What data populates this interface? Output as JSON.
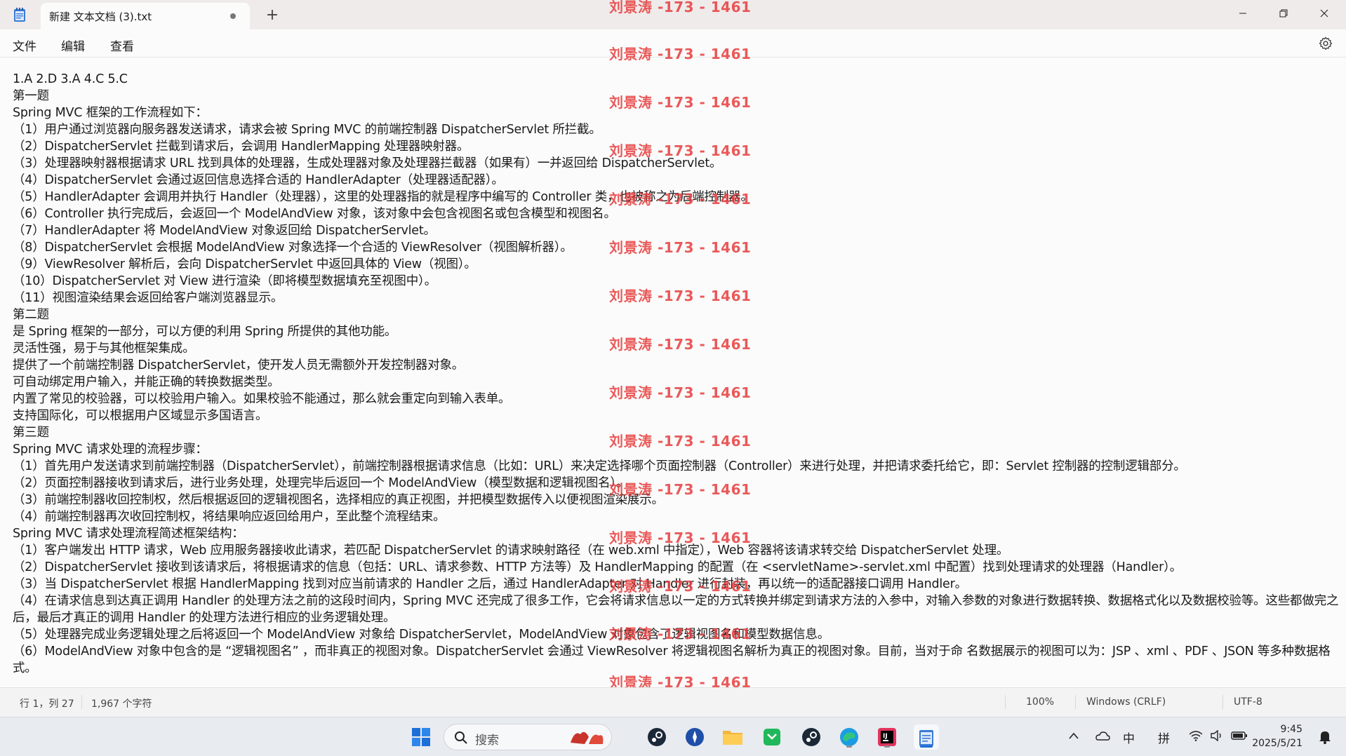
{
  "window": {
    "tab_title": "新建 文本文档 (3).txt",
    "new_tab_label": "+",
    "minimize_icon": "minimize-icon",
    "maximize_icon": "restore-icon",
    "close_icon": "close-icon"
  },
  "menu": {
    "file": "文件",
    "edit": "编辑",
    "view": "查看"
  },
  "document": {
    "lines": [
      "1.A   2.D  3.A   4.C   5.C",
      "第一题",
      "Spring MVC 框架的工作流程如下：",
      "（1）用户通过浏览器向服务器发送请求，请求会被 Spring MVC 的前端控制器 DispatcherServlet 所拦截。",
      "（2）DispatcherServlet 拦截到请求后，会调用 HandlerMapping 处理器映射器。",
      "（3）处理器映射器根据请求 URL 找到具体的处理器，生成处理器对象及处理器拦截器（如果有）一并返回给 DispatcherServlet。",
      "（4）DispatcherServlet 会通过返回信息选择合适的 HandlerAdapter（处理器适配器）。",
      "（5）HandlerAdapter 会调用并执行 Handler（处理器），这里的处理器指的就是程序中编写的 Controller 类，也被称之为后端控制器。",
      "（6）Controller 执行完成后，会返回一个 ModelAndView 对象，该对象中会包含视图名或包含模型和视图名。",
      "（7）HandlerAdapter 将 ModelAndView 对象返回给 DispatcherServlet。",
      "（8）DispatcherServlet 会根据 ModelAndView 对象选择一个合适的 ViewResolver（视图解析器）。",
      "（9）ViewResolver 解析后，会向 DispatcherServlet 中返回具体的 View（视图）。",
      "（10）DispatcherServlet 对 View 进行渲染（即将模型数据填充至视图中）。",
      "（11）视图渲染结果会返回给客户端浏览器显示。",
      "第二题",
      "是 Spring 框架的一部分，可以方便的利用 Spring 所提供的其他功能。",
      "灵活性强，易于与其他框架集成。",
      "提供了一个前端控制器 DispatcherServlet，使开发人员无需额外开发控制器对象。",
      "可自动绑定用户输入，并能正确的转换数据类型。",
      "内置了常见的校验器，可以校验用户输入。如果校验不能通过，那么就会重定向到输入表单。",
      "支持国际化，可以根据用户区域显示多国语言。",
      "第三题",
      "Spring MVC 请求处理的流程步骤：",
      "（1）首先用户发送请求到前端控制器（DispatcherServlet），前端控制器根据请求信息（比如：URL）来决定选择哪个页面控制器（Controller）来进行处理，并把请求委托给它，即：Servlet 控制器的控制逻辑部分。",
      "（2）页面控制器接收到请求后，进行业务处理，处理完毕后返回一个 ModelAndView（模型数据和逻辑视图名）。",
      "（3）前端控制器收回控制权，然后根据返回的逻辑视图名，选择相应的真正视图，并把模型数据传入以便视图渲染展示。",
      "（4）前端控制器再次收回控制权，将结果响应返回给用户，至此整个流程结束。",
      "Spring MVC 请求处理流程简述框架结构：",
      "（1）客户端发出 HTTP 请求，Web 应用服务器接收此请求，若匹配 DispatcherServlet 的请求映射路径（在 web.xml 中指定），Web 容器将该请求转交给 DispatcherServlet 处理。",
      "（2）DispatcherServlet 接收到该请求后，将根据请求的信息（包括：URL、请求参数、HTTP 方法等）及 HandlerMapping 的配置（在 <servletName>-servlet.xml 中配置）找到处理请求的处理器（Handler）。",
      "（3）当 DispatcherServlet 根据 HandlerMapping 找到对应当前请求的 Handler 之后，通过 HandlerAdapter 对 Handler 进行封装，再以统一的适配器接口调用 Handler。"
    ],
    "wrapped_lines": [
      "（4）在请求信息到达真正调用 Handler 的处理方法之前的这段时间内，Spring MVC 还完成了很多工作，它会将请求信息以一定的方式转换并绑定到请求方法的入参中，对输入参数的对象进行数据转换、数据格式化以及数据校验等。这些都做完之后，最后才真正的调用 Handler 的处理方法进行相应的业务逻辑处理。",
      "（5）处理器完成业务逻辑处理之后将返回一个 ModelAndView 对象给 DispatcherServlet，ModelAndView 对象包含了逻辑视图名和模型数据信息。",
      "（6）ModelAndView 对象中包含的是 “逻辑视图名” ，而非真正的视图对象。DispatcherServlet 会通过 ViewResolver 将逻辑视图名解析为真正的视图对象。目前，当对于命 名数据展示的视图可以为：JSP 、xml 、PDF 、JSON 等多种数据格式。"
    ]
  },
  "watermark": "刘景涛 -173 - 1461",
  "statusbar": {
    "position": "行 1，列 27",
    "char_count": "1,967 个字符",
    "zoom": "100%",
    "line_ending": "Windows (CRLF)",
    "encoding": "UTF-8"
  },
  "taskbar": {
    "search_placeholder": "搜索",
    "tray_lang": "中",
    "tray_ime": "拼",
    "time": "9:45",
    "date": "2025/5/21"
  },
  "colors": {
    "watermark": "#e63c3c",
    "accent": "#1d6fd8"
  }
}
